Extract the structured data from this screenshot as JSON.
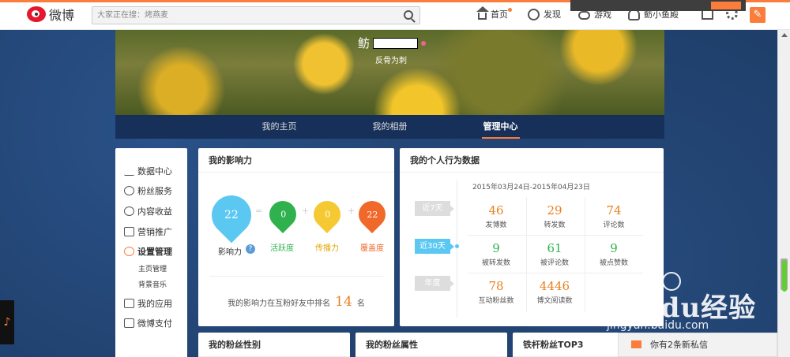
{
  "topbar": {
    "logo_text": "微博",
    "search_placeholder": "大家正在搜：烤燕麦",
    "nav": [
      {
        "label": "首页"
      },
      {
        "label": "发现"
      },
      {
        "label": "游戏"
      },
      {
        "label": "鲂小鱼殿"
      }
    ]
  },
  "profile": {
    "name_prefix": "鲂",
    "intro": "反骨为刺"
  },
  "tabs": [
    {
      "label": "我的主页"
    },
    {
      "label": "我的相册"
    },
    {
      "label": "管理中心"
    }
  ],
  "sidebar": {
    "items": [
      {
        "label": "数据中心"
      },
      {
        "label": "粉丝服务"
      },
      {
        "label": "内容收益"
      },
      {
        "label": "营销推广"
      },
      {
        "label": "设置管理"
      },
      {
        "label": "主页管理"
      },
      {
        "label": "背景音乐"
      },
      {
        "label": "我的应用"
      },
      {
        "label": "微博支付"
      }
    ]
  },
  "influence": {
    "title": "我的影响力",
    "total": {
      "value": "22",
      "label": "影响力"
    },
    "active": {
      "value": "0",
      "label": "活跃度"
    },
    "spread": {
      "value": "0",
      "label": "传播力"
    },
    "coverage": {
      "value": "22",
      "label": "覆盖度"
    },
    "op_eq": "=",
    "op_plus": "+",
    "rank_prefix": "我的影响力在互粉好友中排名",
    "rank_value": "14",
    "rank_suffix": "名"
  },
  "behavior": {
    "title": "我的个人行为数据",
    "date_range": "2015年03月24日-2015年04月23日",
    "periods": [
      {
        "label": "近7天"
      },
      {
        "label": "近30天"
      },
      {
        "label": "年度"
      }
    ],
    "stats": [
      {
        "value": "46",
        "label": "发博数"
      },
      {
        "value": "29",
        "label": "转发数"
      },
      {
        "value": "74",
        "label": "评论数"
      },
      {
        "value": "9",
        "label": "被转发数"
      },
      {
        "value": "61",
        "label": "被评论数"
      },
      {
        "value": "9",
        "label": "被点赞数"
      },
      {
        "value": "78",
        "label": "互动粉丝数"
      },
      {
        "value": "4446",
        "label": "博文阅读数"
      }
    ]
  },
  "bottom_cards": [
    {
      "title": "我的粉丝性别"
    },
    {
      "title": "我的粉丝属性"
    },
    {
      "title": "铁杆粉丝TOP3"
    }
  ],
  "message": "你有2条新私信",
  "music_glyph": "♪",
  "watermark": {
    "brand": "Baidu经验",
    "url": "jingyan.baidu.com"
  },
  "colors": {
    "accent": "#fa7d3c",
    "blue": "#5bc8f2",
    "green": "#2fb24e",
    "yellow": "#f5c932",
    "orange": "#f0682a"
  }
}
